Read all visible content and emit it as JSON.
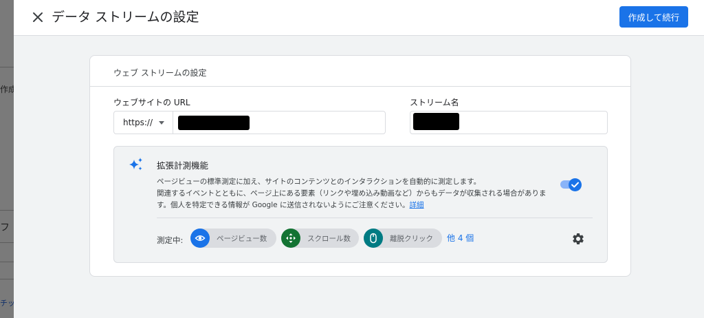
{
  "background": {
    "text_create": "作成",
    "text_fu": "フ",
    "text_link": "チッ"
  },
  "header": {
    "close_icon": "close-icon",
    "title": "データ ストリームの設定",
    "primary_button": "作成して続行"
  },
  "card": {
    "title": "ウェブ ストリームの設定",
    "url_label": "ウェブサイトの URL",
    "protocol_value": "https://",
    "stream_name_label": "ストリーム名"
  },
  "enhanced_measurement": {
    "title": "拡張計測機能",
    "description_lines": [
      "ページビューの標準測定に加え、サイトのコンテンツとのインタラクションを自動的に測定します。",
      "関連するイベントとともに、ページ上にある要素（リンクや埋め込み動画など）からもデータが収集される場合がありま",
      "す。個人を特定できる情報が Google に送信されないようにご注意ください。"
    ],
    "details_link": "詳細",
    "toggle_on": true,
    "measuring_label": "測定中:",
    "chips": [
      {
        "label": "ページビュー数",
        "icon": "eye-icon",
        "color": "#1a73e8"
      },
      {
        "label": "スクロール数",
        "icon": "scroll-arrows-icon",
        "color": "#137333"
      },
      {
        "label": "離脱クリック",
        "icon": "mouse-icon",
        "color": "#007b83"
      }
    ],
    "more_link": "他 4 個",
    "settings_icon": "gear-icon"
  },
  "colors": {
    "accent": "#1a73e8",
    "background": "#f1f3f4"
  }
}
